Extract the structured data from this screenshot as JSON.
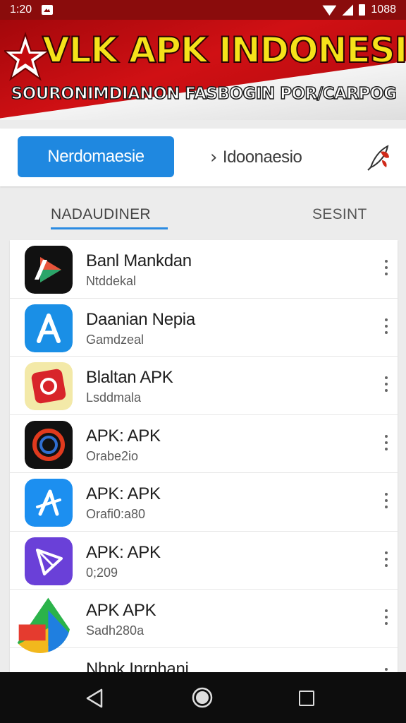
{
  "status_bar": {
    "time": "1:20",
    "battery": "1088"
  },
  "banner": {
    "title": "VLK APK INDONESIA",
    "subtitle": "SOURONIMDIANON FASBOGIN POR/CARPOG"
  },
  "action_card": {
    "primary_button": "Nerdomaesie",
    "secondary_link": "Idoonaesio"
  },
  "tabs": [
    {
      "label": "NADAUDINER",
      "active": true
    },
    {
      "label": "SESINT",
      "active": false
    }
  ],
  "apps": [
    {
      "name": "Banl Mankdan",
      "sub": "Ntddekal",
      "icon": "play-arrow-icon"
    },
    {
      "name": "Daanian Nepia",
      "sub": "Gamdzeal",
      "icon": "app-store-a-icon"
    },
    {
      "name": "Blaltan APK",
      "sub": "Lsddmala",
      "icon": "red-swirl-icon"
    },
    {
      "name": "APK: APK",
      "sub": "Orabe2io",
      "icon": "circle-ring-icon"
    },
    {
      "name": "APK: APK",
      "sub": "Orafi0:a80",
      "icon": "app-store-pencil-icon"
    },
    {
      "name": "APK: APK",
      "sub": "0;209",
      "icon": "purple-play-icon"
    },
    {
      "name": "APK APK",
      "sub": "Sadh280a",
      "icon": "colorful-apk-icon"
    },
    {
      "name": "Nhnk Inrnhani",
      "sub": "",
      "icon": "generic-app-icon"
    }
  ],
  "colors": {
    "status_bar": "#8a0c0c",
    "banner_red": "#d01014",
    "banner_title": "#f5e21a",
    "primary_blue": "#1f88e0",
    "tab_underline": "#2b8be2",
    "nav_bar": "#0d0d0d"
  }
}
